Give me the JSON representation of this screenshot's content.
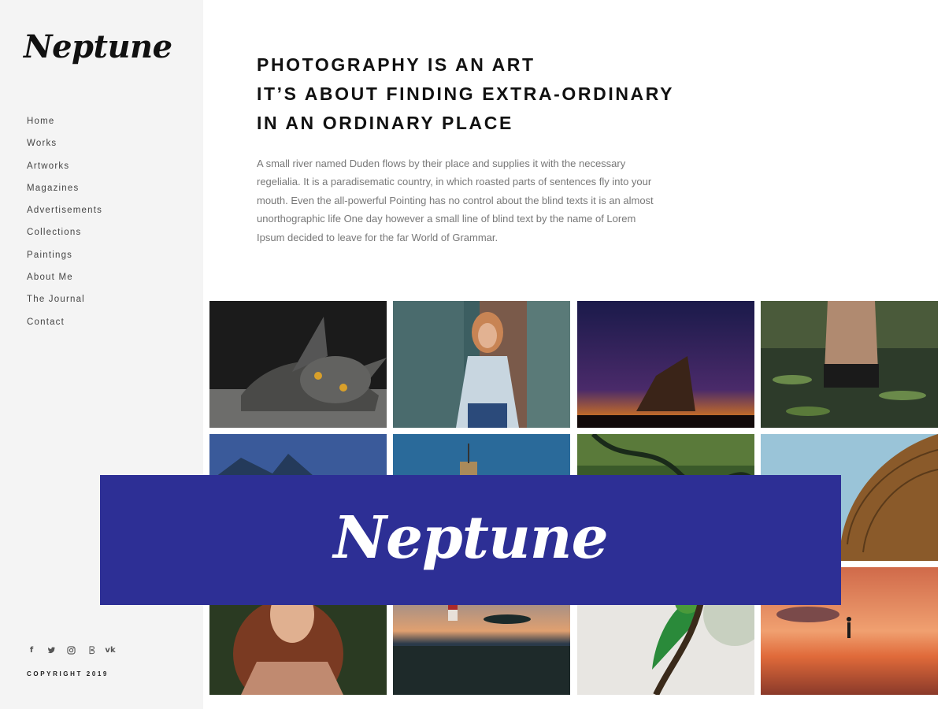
{
  "brand": {
    "name": "Neptune"
  },
  "nav": {
    "items": [
      {
        "label": "Home"
      },
      {
        "label": "Works"
      },
      {
        "label": "Artworks"
      },
      {
        "label": "Magazines"
      },
      {
        "label": "Advertisements"
      },
      {
        "label": "Collections"
      },
      {
        "label": "Paintings"
      },
      {
        "label": "About Me"
      },
      {
        "label": "The Journal"
      },
      {
        "label": "Contact"
      }
    ]
  },
  "social": {
    "icons": [
      "facebook-icon",
      "twitter-icon",
      "instagram-icon",
      "google-plus-icon",
      "vk-icon"
    ],
    "facebook": "f",
    "vk": "vk"
  },
  "footer": {
    "copyright": "COPYRIGHT 2019"
  },
  "hero": {
    "lines": [
      "PHOTOGRAPHY IS AN ART",
      "IT’S ABOUT FINDING EXTRA-ORDINARY",
      "IN AN ORDINARY PLACE"
    ],
    "paragraph": "A small river named Duden flows by their place and supplies it with the necessary regelialia. It is a paradisematic country, in which roasted parts of sentences fly into your mouth. Even the all-powerful Pointing has no control about the blind texts it is an almost unorthographic life One day however a small line of blind text by the name of Lorem Ipsum decided to leave for the far World of Grammar."
  },
  "banner": {
    "logo": "Neptune",
    "background": "#2d2f95"
  },
  "colors": {
    "sidebar_bg": "#f4f4f4",
    "accent": "#2d2f95"
  }
}
